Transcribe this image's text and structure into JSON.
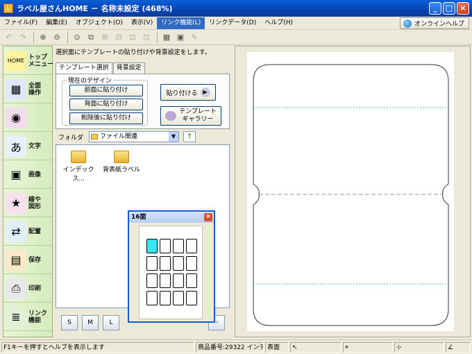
{
  "window": {
    "title": "ラベル屋さんHOME － 名称未設定 (468%)",
    "app_icon": "L"
  },
  "menu": [
    "ファイル(F)",
    "編集(E)",
    "オブジェクト(O)",
    "表示(V)",
    "リンク機能(L)",
    "リンクデータ(D)",
    "ヘルプ(H)"
  ],
  "menu_active_index": 4,
  "online_help_label": "オンラインヘルプ",
  "sidebar": {
    "items": [
      {
        "label": "トップ\nメニュー",
        "icon": "home-icon",
        "glyph": "HOME"
      },
      {
        "label": "全面\n操作",
        "icon": "full-surface-icon",
        "glyph": "▦"
      },
      {
        "label": "",
        "icon": "cd-print-icon",
        "glyph": "◉"
      },
      {
        "label": "文字",
        "icon": "text-icon",
        "glyph": "あ"
      },
      {
        "label": "画像",
        "icon": "image-icon",
        "glyph": "▣"
      },
      {
        "label": "線や\n図形",
        "icon": "shape-icon",
        "glyph": "★"
      },
      {
        "label": "配置",
        "icon": "layout-icon",
        "glyph": "⇄"
      },
      {
        "label": "保存",
        "icon": "save-icon",
        "glyph": "▤"
      },
      {
        "label": "印刷",
        "icon": "print-icon",
        "glyph": "⎙"
      },
      {
        "label": "リンク\n機能",
        "icon": "link-icon",
        "glyph": "≣"
      }
    ]
  },
  "panel": {
    "hint": "選択面にテンプレートの貼り付けや背景設定をします。",
    "tabs": [
      "テンプレート選択",
      "背景設定"
    ],
    "group_title": "現在のデザイン",
    "buttons": {
      "front": "前面に貼り付け",
      "back": "背面に貼り付け",
      "delete": "削除後に貼り付け",
      "paste": "貼り付ける",
      "gallery_line1": "テンプレート",
      "gallery_line2": "ギャラリー"
    },
    "folder_label": "フォルダ",
    "folder_value": "ファイル関連",
    "files": [
      "インデックス...",
      "背表紙ラベル"
    ],
    "bottom_buttons": [
      "S",
      "M",
      "L"
    ]
  },
  "popup": {
    "title": "16面",
    "selected_index": 0
  },
  "status": {
    "help": "F1キーを押すとヘルプを表示します",
    "product": "商品番号:29322 インデ",
    "side": "表面"
  },
  "colors": {
    "titlebar": "#0a5fd8",
    "selected_cell": "#33e8f4",
    "guide_line": "#33c8d8"
  }
}
